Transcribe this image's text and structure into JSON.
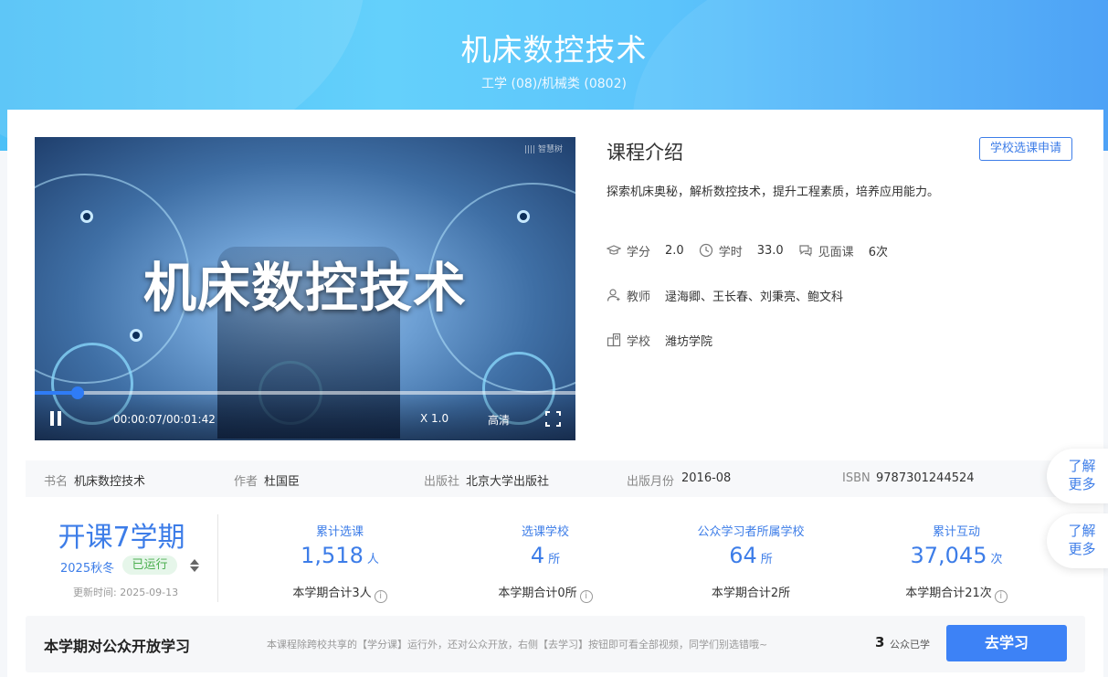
{
  "header": {
    "course_title": "机床数控技术",
    "category": "工学 (08)/机械类 (0802)"
  },
  "video": {
    "overlay_title": "机床数控技术",
    "watermark": "|||| 智慧树",
    "time": "00:00:07/00:01:42",
    "speed": "X 1.0",
    "quality": "高清",
    "progress_fraction": 0.08
  },
  "intro": {
    "title": "课程介绍",
    "apply_button": "学校选课申请",
    "description": "探索机床奥秘，解析数控技术，提升工程素质，培养应用能力。",
    "credit_label": "学分",
    "credit_value": "2.0",
    "hours_label": "学时",
    "hours_value": "33.0",
    "meet_label": "见面课",
    "meet_value": "6次",
    "teacher_label": "教师",
    "teacher_value": "逯海卿、王长春、刘秉亮、鲍文科",
    "school_label": "学校",
    "school_value": "潍坊学院"
  },
  "book": {
    "name_label": "书名",
    "name_value": "机床数控技术",
    "author_label": "作者",
    "author_value": "杜国臣",
    "publisher_label": "出版社",
    "publisher_value": "北京大学出版社",
    "date_label": "出版月份",
    "date_value": "2016-08",
    "isbn_label": "ISBN",
    "isbn_value": "9787301244524"
  },
  "term": {
    "big": "开课7学期",
    "current": "2025秋冬",
    "status": "已运行",
    "updated": "更新时间:   2025-09-13"
  },
  "stats": [
    {
      "label": "累计选课",
      "value": "1,518",
      "unit": "人",
      "sub": "本学期合计3人"
    },
    {
      "label": "选课学校",
      "value": "4",
      "unit": "所",
      "sub": "本学期合计0所"
    },
    {
      "label": "公众学习者所属学校",
      "value": "64",
      "unit": "所",
      "sub": "本学期合计2所"
    },
    {
      "label": "累计互动",
      "value": "37,045",
      "unit": "次",
      "sub": "本学期合计21次"
    }
  ],
  "floats": {
    "more1_line1": "了解",
    "more1_line2": "更多",
    "more2_line1": "了解",
    "more2_line2": "更多"
  },
  "bottom": {
    "title": "本学期对公众开放学习",
    "note": "本课程除跨校共享的【学分课】运行外，还对公众开放，右侧【去学习】按钮即可看全部视频，同学们别选错哦~",
    "count": "3",
    "count_label": "公众已学",
    "go_button": "去学习"
  },
  "colors": {
    "accent": "#3d7de8",
    "running": "#4caf50"
  }
}
